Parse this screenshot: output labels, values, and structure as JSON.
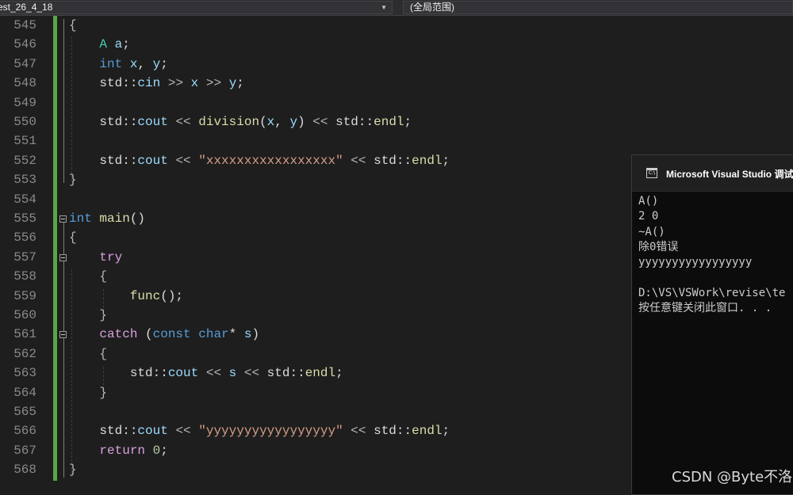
{
  "navbar": {
    "file_combo": "est_26_4_18",
    "scope_combo": "(全局范围)"
  },
  "editor": {
    "line_numbers": [
      "545",
      "546",
      "547",
      "548",
      "549",
      "550",
      "551",
      "552",
      "553",
      "554",
      "555",
      "556",
      "557",
      "558",
      "559",
      "560",
      "561",
      "562",
      "563",
      "564",
      "565",
      "566",
      "567",
      "568"
    ],
    "strings": {
      "xs": "\"xxxxxxxxxxxxxxxxx\"",
      "ys": "\"yyyyyyyyyyyyyyyyy\""
    }
  },
  "console": {
    "title": "Microsoft Visual Studio 调试控",
    "icon_label": "C:\\",
    "lines": [
      "A()",
      "2 0",
      "~A()",
      "除0错误",
      "yyyyyyyyyyyyyyyyy",
      "",
      "D:\\VS\\VSWork\\revise\\te",
      "按任意键关闭此窗口. . ."
    ]
  },
  "watermark": "CSDN @Byte不洛",
  "colors": {
    "background": "#1e1e1e",
    "keyword": "#569cd6",
    "control": "#d8a0df",
    "type": "#4ec9b0",
    "variable": "#9cdcfe",
    "function": "#dcdcaa",
    "string": "#d69d85",
    "number": "#b5cea8",
    "change_bar": "#57a64a"
  }
}
